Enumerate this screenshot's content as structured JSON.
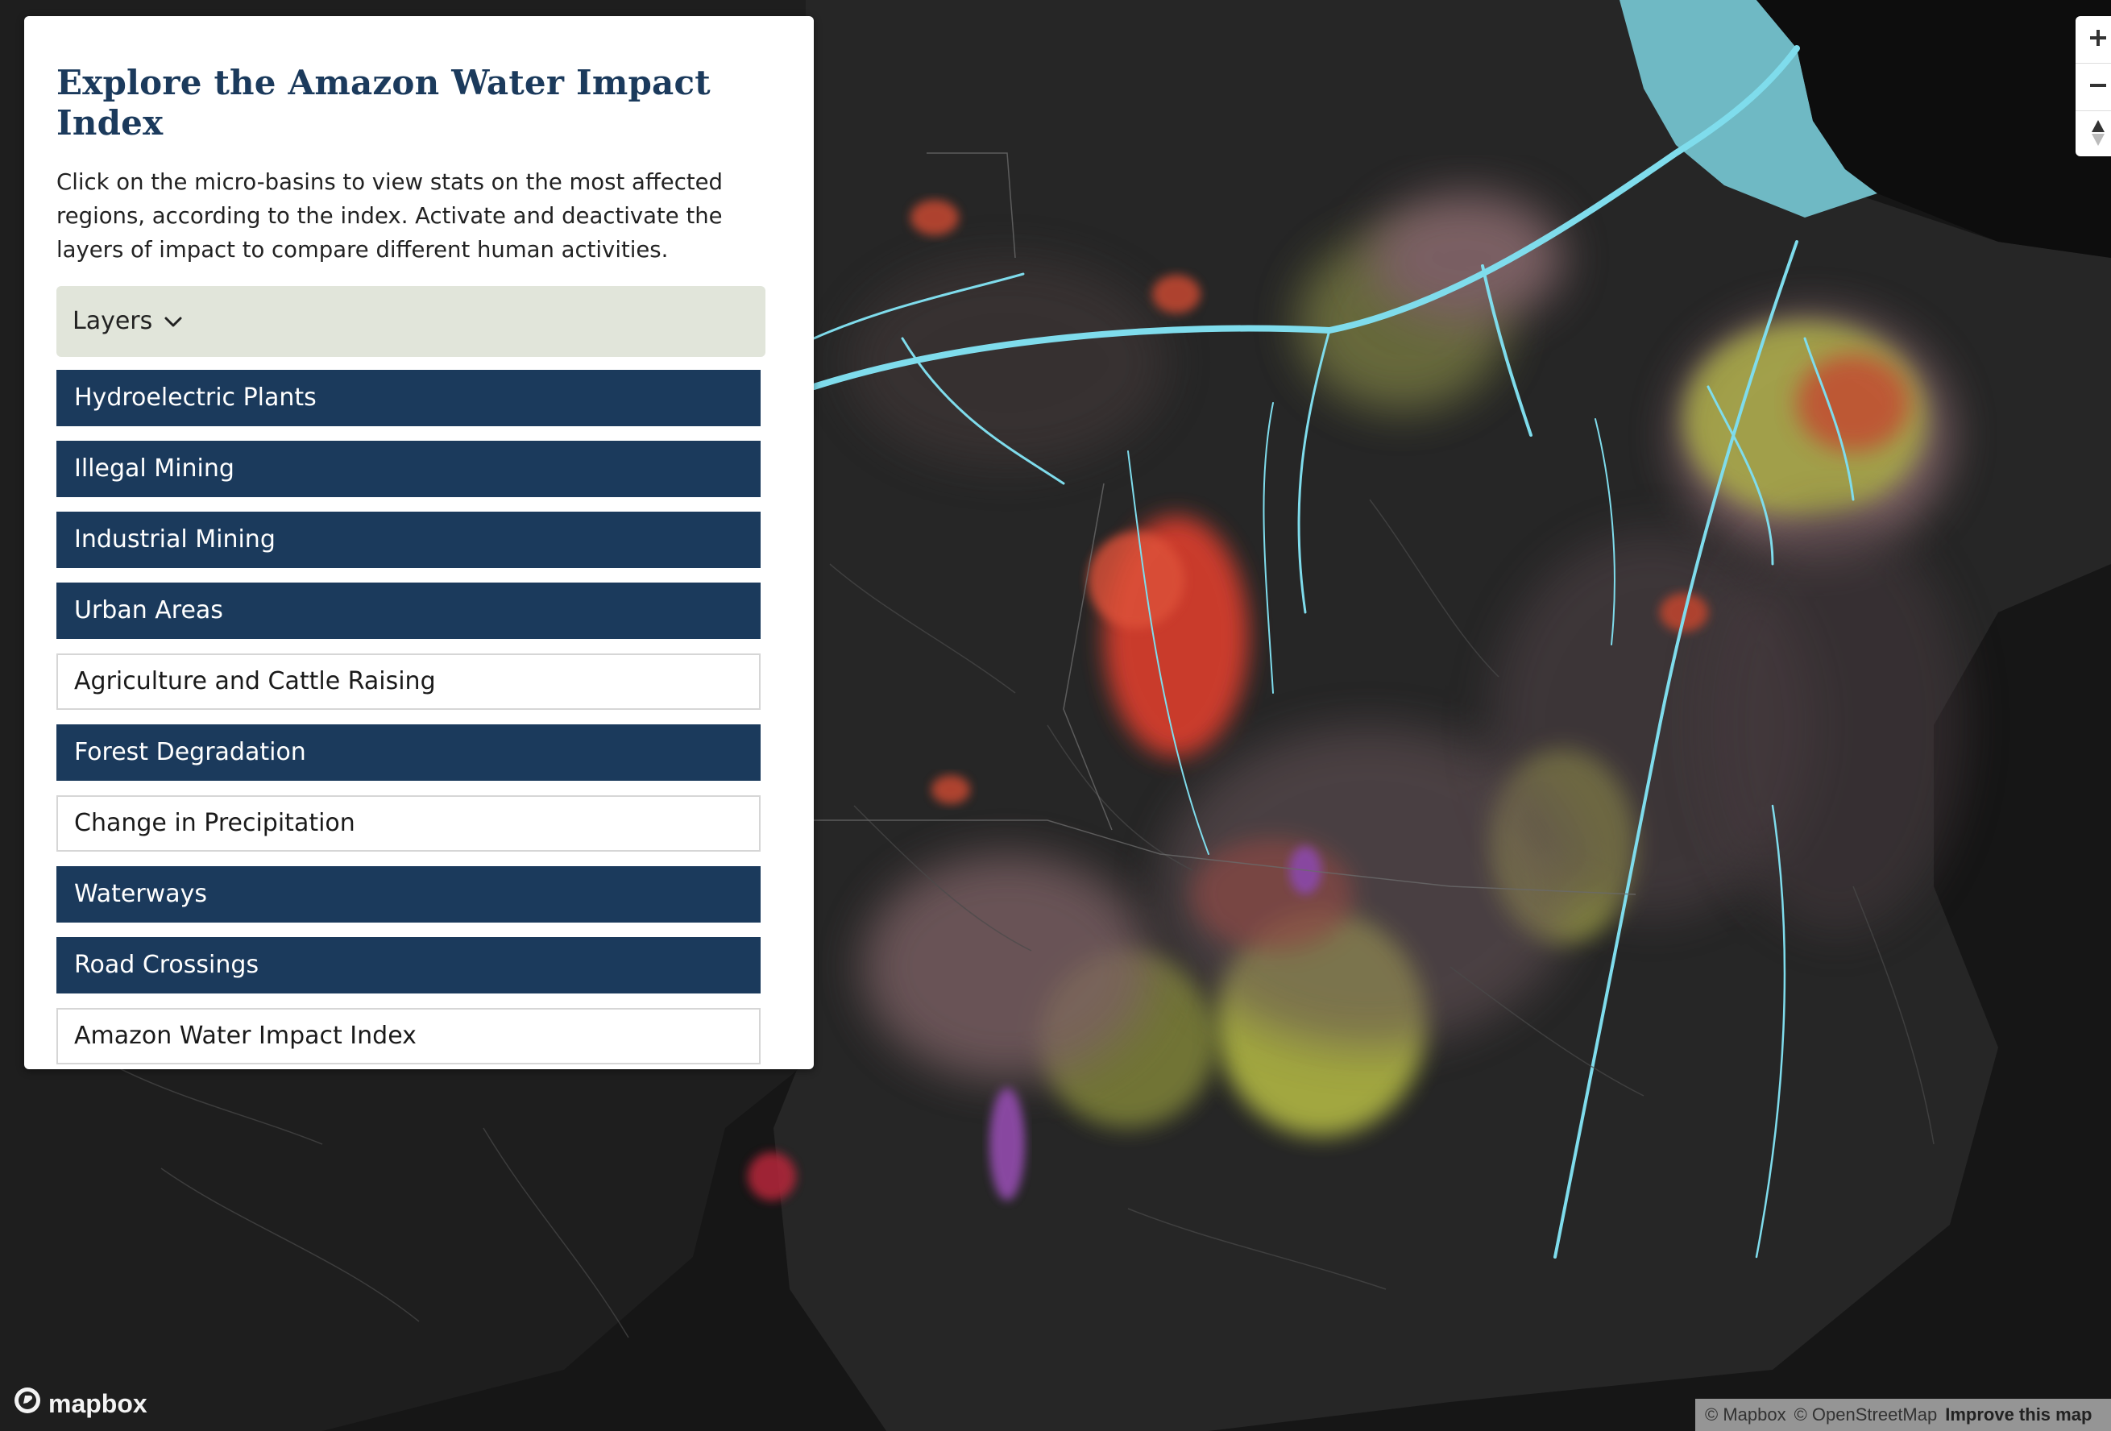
{
  "panel": {
    "title": "Explore the Amazon Water Impact Index",
    "description": "Click on the micro-basins to view stats on the most affected regions, according to the index. Activate and deactivate the layers of impact to compare different human activities.",
    "layers_toggle": {
      "label": "Layers",
      "icon": "chevron-down-icon",
      "expanded": true
    },
    "layers": [
      {
        "label": "Hydroelectric Plants",
        "active": true
      },
      {
        "label": "Illegal Mining",
        "active": true
      },
      {
        "label": "Industrial Mining",
        "active": true
      },
      {
        "label": "Urban Areas",
        "active": true
      },
      {
        "label": "Agriculture and Cattle Raising",
        "active": false
      },
      {
        "label": "Forest Degradation",
        "active": true
      },
      {
        "label": "Change in Precipitation",
        "active": false
      },
      {
        "label": "Waterways",
        "active": true
      },
      {
        "label": "Road Crossings",
        "active": true
      },
      {
        "label": "Amazon Water Impact Index",
        "active": false
      }
    ]
  },
  "map_controls": {
    "zoom_in_icon": "plus-icon",
    "zoom_out_icon": "minus-icon",
    "compass_icon": "compass-icon"
  },
  "attribution": {
    "mapbox": "© Mapbox",
    "osm": "© OpenStreetMap",
    "improve": "Improve this map"
  },
  "logo": {
    "text": "mapbox"
  },
  "colors": {
    "panel_title": "#1b3a5c",
    "active_layer": "#1b3a5c",
    "toggle_bg": "#e1e5da",
    "map_bg": "#161616",
    "water": "#7fdcec",
    "ocean": "#6fb9c4",
    "impact_high": "#e8402e",
    "impact_mid": "#c9d04a",
    "impact_low": "#8a6a6e",
    "impact_purple": "#9b4fb8"
  }
}
